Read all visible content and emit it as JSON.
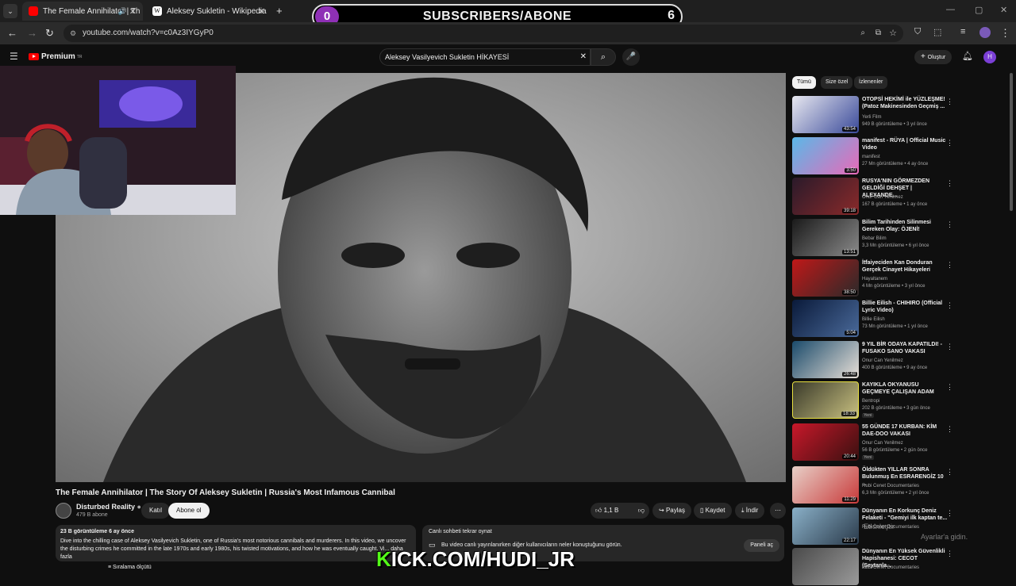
{
  "browser": {
    "tabs": [
      {
        "label": "The Female Annihilator | Th"
      },
      {
        "label": "Aleksey Sukletin - Wikipedia"
      }
    ],
    "new_tab": "+",
    "url": "youtube.com/watch?v=c0Az3IYGyP0"
  },
  "overlay": {
    "left_count": "0",
    "title": "SUBSCRIBERS/ABONE",
    "right_count": "6",
    "kick_prefix": "K",
    "kick_rest": "ICK.COM/HUDI_JR",
    "windows_line1": "Etkinleştir",
    "windows_line2": "Ayarlar'a gidin."
  },
  "youtube": {
    "logo": "Premium",
    "logo_sup": "TR",
    "search_value": "Aleksey Vasilyevich Sukletin HİKAYESİ",
    "create_label": "Oluştur",
    "avatar_letter": "H"
  },
  "video": {
    "title": "The Female Annihilator | The Story Of Aleksey Sukletin | Russia's Most Infamous Cannibal",
    "channel_name": "Disturbed Reality",
    "channel_subs": "479 B abone",
    "join_label": "Katıl",
    "subscribe_label": "Abone ol",
    "likes": "1,1 B",
    "share_label": "Paylaş",
    "save_label": "Kaydet",
    "download_label": "İndir",
    "desc_meta": "23 B görüntüleme  6 ay önce",
    "desc_text": "Dive into the chilling case of Aleksey Vasilyevich Sukletin, one of Russia's most notorious cannibals and murderers. In this video, we uncover the disturbing crimes he committed in the late 1970s and early 1980s, his twisted motivations, and how he was eventually caught. Vi... daha fazla",
    "chat_title": "Canlı sohbeti tekrar oynat",
    "chat_text": "Bu video canlı yayınlanırken diğer kullanıcıların neler konuştuğunu görün.",
    "chat_button": "Paneli aç",
    "comments_label": "Sıralama ölçütü"
  },
  "sidebar": {
    "chips": [
      "Tümü",
      "Size özel",
      "İzlenenler"
    ],
    "items": [
      {
        "title": "OTOPSİ HEKİMİ ile YÜZLEŞME! (Patoz Makinesinden Geçmiş ...",
        "channel": "Yerli Film",
        "meta": "949 B görüntüleme • 3 yıl önce",
        "duration": "43:54",
        "badge": ""
      },
      {
        "title": "manifest - RÜYA | Official Music Video",
        "channel": "manifest",
        "meta": "27 Mn görüntüleme • 4 ay önce",
        "duration": "3:50",
        "badge": ""
      },
      {
        "title": "RUSYA'NIN GÖRMEZDEN GELDİĞİ DEHŞET | ALEXANDE...",
        "channel": "Onur Can Yenilmez",
        "meta": "167 B görüntüleme • 1 ay önce",
        "duration": "39:18",
        "badge": ""
      },
      {
        "title": "Bilim Tarihinden Silinmesi Gereken Olay: ÖJENİ!",
        "channel": "Bebar Bilim",
        "meta": "3,3 Mn görüntüleme • 6 yıl önce",
        "duration": "13:51",
        "badge": ""
      },
      {
        "title": "İtfaiyeciden Kan Donduran Gerçek Cinayet Hikayeleri",
        "channel": "Hayaltanem",
        "meta": "4 Mn görüntüleme • 3 yıl önce",
        "duration": "38:50",
        "badge": ""
      },
      {
        "title": "Billie Eilish - CHIHIRO (Official Lyric Video)",
        "channel": "Billie Eilish",
        "meta": "73 Mn görüntüleme • 1 yıl önce",
        "duration": "5:04",
        "badge": ""
      },
      {
        "title": "9 YIL BİR ODAYA KAPATILDI! - FUSAKO SANO VAKASI",
        "channel": "Onur Can Yenilmez",
        "meta": "400 B görüntüleme • 9 ay önce",
        "duration": "26:48",
        "badge": ""
      },
      {
        "title": "KAYIKLA OKYANUSU GEÇMEYE ÇALIŞAN ADAM",
        "channel": "Bentropi",
        "meta": "202 B görüntüleme • 3 gün önce",
        "duration": "18:33",
        "badge": "Yeni"
      },
      {
        "title": "55 GÜNDE 17 KURBAN: KİM DAE-DOO VAKASI",
        "channel": "Onur Can Yenilmez",
        "meta": "56 B görüntüleme • 2 gün önce",
        "duration": "20:44",
        "badge": "Yeni"
      },
      {
        "title": "Öldükten YILLAR SONRA Bulunmuş En ESRARENGİZ 10 ...",
        "channel": "Rubi Cenet Documentaries",
        "meta": "6,3 Mn görüntüleme • 2 yıl önce",
        "duration": "11:29",
        "badge": ""
      },
      {
        "title": "Dünyanın En Korkunç Deniz Felaketi - \"Gemiyi ilk kaptan te...",
        "channel": "Rubi Cenet Documentaries",
        "meta": "",
        "duration": "22:17",
        "badge": ""
      },
      {
        "title": "Dünyanın En Yüksek Güvenlikli Hapishanesi: CECOT (Şeytanla...",
        "channel": "Rubi Cenet Documentaries",
        "meta": "",
        "duration": "",
        "badge": ""
      }
    ]
  },
  "colors": {
    "accent": "#8f30b6",
    "kick_green": "#53fc18",
    "youtube_red": "#ff0000"
  }
}
